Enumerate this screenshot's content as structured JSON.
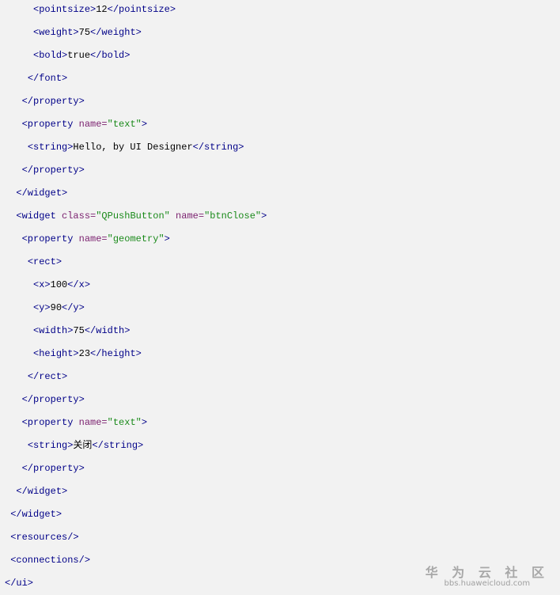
{
  "lines": [
    {
      "indent": 5,
      "tokens": [
        {
          "c": "tag",
          "v": "<pointsize>"
        },
        {
          "c": "txt",
          "v": "12"
        },
        {
          "c": "tag",
          "v": "</pointsize>"
        }
      ]
    },
    {
      "indent": 5,
      "tokens": [
        {
          "c": "tag",
          "v": "<weight>"
        },
        {
          "c": "txt",
          "v": "75"
        },
        {
          "c": "tag",
          "v": "</weight>"
        }
      ]
    },
    {
      "indent": 5,
      "tokens": [
        {
          "c": "tag",
          "v": "<bold>"
        },
        {
          "c": "txt",
          "v": "true"
        },
        {
          "c": "tag",
          "v": "</bold>"
        }
      ]
    },
    {
      "indent": 4,
      "tokens": [
        {
          "c": "tag",
          "v": "</font>"
        }
      ]
    },
    {
      "indent": 3,
      "tokens": [
        {
          "c": "tag",
          "v": "</property>"
        }
      ]
    },
    {
      "indent": 3,
      "tokens": [
        {
          "c": "tag",
          "v": "<property "
        },
        {
          "c": "attr",
          "v": "name="
        },
        {
          "c": "val",
          "v": "\"text\""
        },
        {
          "c": "tag",
          "v": ">"
        }
      ]
    },
    {
      "indent": 4,
      "tokens": [
        {
          "c": "tag",
          "v": "<string>"
        },
        {
          "c": "txt",
          "v": "Hello, by UI Designer"
        },
        {
          "c": "tag",
          "v": "</string>"
        }
      ]
    },
    {
      "indent": 3,
      "tokens": [
        {
          "c": "tag",
          "v": "</property>"
        }
      ]
    },
    {
      "indent": 2,
      "tokens": [
        {
          "c": "tag",
          "v": "</widget>"
        }
      ]
    },
    {
      "indent": 2,
      "tokens": [
        {
          "c": "tag",
          "v": "<widget "
        },
        {
          "c": "attr",
          "v": "class="
        },
        {
          "c": "val",
          "v": "\"QPushButton\""
        },
        {
          "c": "attr",
          "v": " name="
        },
        {
          "c": "val",
          "v": "\"btnClose\""
        },
        {
          "c": "tag",
          "v": ">"
        }
      ]
    },
    {
      "indent": 3,
      "tokens": [
        {
          "c": "tag",
          "v": "<property "
        },
        {
          "c": "attr",
          "v": "name="
        },
        {
          "c": "val",
          "v": "\"geometry\""
        },
        {
          "c": "tag",
          "v": ">"
        }
      ]
    },
    {
      "indent": 4,
      "tokens": [
        {
          "c": "tag",
          "v": "<rect>"
        }
      ]
    },
    {
      "indent": 5,
      "tokens": [
        {
          "c": "tag",
          "v": "<x>"
        },
        {
          "c": "txt",
          "v": "100"
        },
        {
          "c": "tag",
          "v": "</x>"
        }
      ]
    },
    {
      "indent": 5,
      "tokens": [
        {
          "c": "tag",
          "v": "<y>"
        },
        {
          "c": "txt",
          "v": "90"
        },
        {
          "c": "tag",
          "v": "</y>"
        }
      ]
    },
    {
      "indent": 5,
      "tokens": [
        {
          "c": "tag",
          "v": "<width>"
        },
        {
          "c": "txt",
          "v": "75"
        },
        {
          "c": "tag",
          "v": "</width>"
        }
      ]
    },
    {
      "indent": 5,
      "tokens": [
        {
          "c": "tag",
          "v": "<height>"
        },
        {
          "c": "txt",
          "v": "23"
        },
        {
          "c": "tag",
          "v": "</height>"
        }
      ]
    },
    {
      "indent": 4,
      "tokens": [
        {
          "c": "tag",
          "v": "</rect>"
        }
      ]
    },
    {
      "indent": 3,
      "tokens": [
        {
          "c": "tag",
          "v": "</property>"
        }
      ]
    },
    {
      "indent": 3,
      "tokens": [
        {
          "c": "tag",
          "v": "<property "
        },
        {
          "c": "attr",
          "v": "name="
        },
        {
          "c": "val",
          "v": "\"text\""
        },
        {
          "c": "tag",
          "v": ">"
        }
      ]
    },
    {
      "indent": 4,
      "tokens": [
        {
          "c": "tag",
          "v": "<string>"
        },
        {
          "c": "txt",
          "v": "关闭"
        },
        {
          "c": "tag",
          "v": "</string>"
        }
      ]
    },
    {
      "indent": 3,
      "tokens": [
        {
          "c": "tag",
          "v": "</property>"
        }
      ]
    },
    {
      "indent": 2,
      "tokens": [
        {
          "c": "tag",
          "v": "</widget>"
        }
      ]
    },
    {
      "indent": 1,
      "tokens": [
        {
          "c": "tag",
          "v": "</widget>"
        }
      ]
    },
    {
      "indent": 1,
      "tokens": [
        {
          "c": "tag",
          "v": "<resources/>"
        }
      ]
    },
    {
      "indent": 1,
      "tokens": [
        {
          "c": "tag",
          "v": "<connections/>"
        }
      ]
    },
    {
      "indent": 0,
      "tokens": [
        {
          "c": "tag",
          "v": "</ui>"
        }
      ]
    }
  ],
  "watermark": {
    "name": "华 为 云 社 区",
    "url": "bbs.huaweicloud.com"
  },
  "colors": {
    "background": "#f2f2f2",
    "tag": "#000088",
    "attr": "#7a1f6e",
    "value": "#1a8a1a",
    "text": "#000000"
  }
}
